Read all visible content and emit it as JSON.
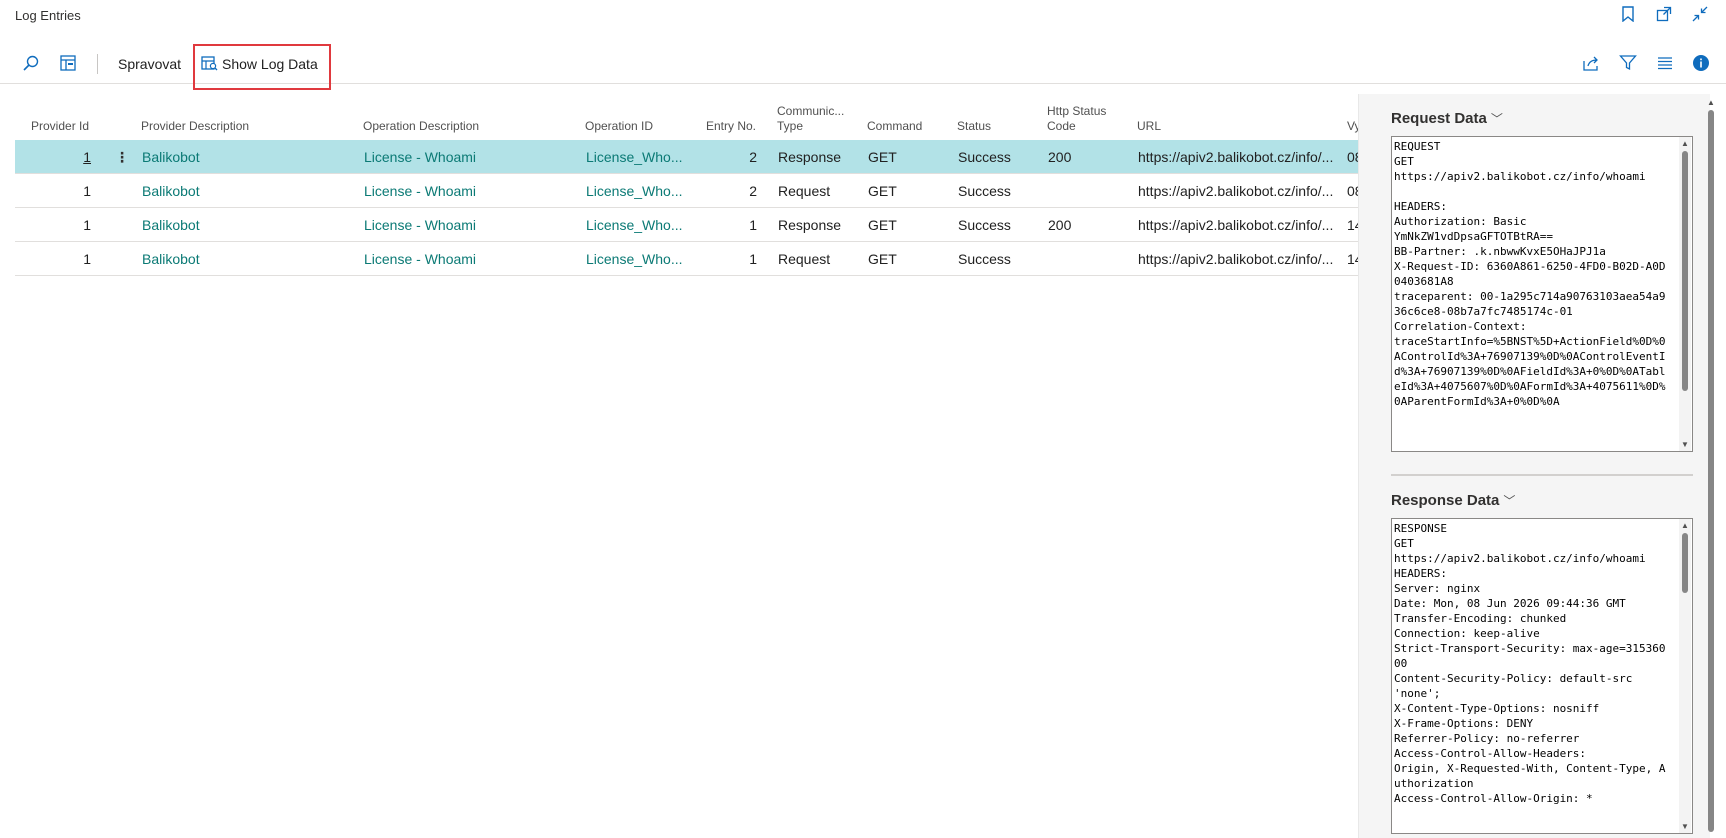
{
  "window": {
    "title": "Log Entries",
    "icons": [
      "bookmark-icon",
      "open-new-window-icon",
      "collapse-icon"
    ]
  },
  "actions": {
    "search_icon": "search-icon",
    "edit_list_icon": "edit-list-icon",
    "manage_label": "Spravovat",
    "show_log_data_label": "Show Log Data",
    "right_icons": [
      "share-icon",
      "filter-icon",
      "list-view-icon",
      "info-icon"
    ]
  },
  "grid": {
    "columns": {
      "provider_id": "Provider Id",
      "provider_description": "Provider Description",
      "operation_description": "Operation Description",
      "operation_id": "Operation ID",
      "entry_no": "Entry No.",
      "communication_type_line1": "Communic...",
      "communication_type_line2": "Type",
      "command": "Command",
      "status": "Status",
      "http_status_line1": "Http Status",
      "http_status_line2": "Code",
      "url": "URL",
      "extra": "Vy"
    },
    "rows": [
      {
        "provider_id": "1",
        "provider_description": "Balikobot",
        "operation_description": "License - Whoami",
        "operation_id": "License_Who...",
        "entry_no": "2",
        "type": "Response",
        "command": "GET",
        "status": "Success",
        "http_status": "200",
        "url": "https://apiv2.balikobot.cz/info/...",
        "extra": "08"
      },
      {
        "provider_id": "1",
        "provider_description": "Balikobot",
        "operation_description": "License - Whoami",
        "operation_id": "License_Who...",
        "entry_no": "2",
        "type": "Request",
        "command": "GET",
        "status": "Success",
        "http_status": "",
        "url": "https://apiv2.balikobot.cz/info/...",
        "extra": "08"
      },
      {
        "provider_id": "1",
        "provider_description": "Balikobot",
        "operation_description": "License - Whoami",
        "operation_id": "License_Who...",
        "entry_no": "1",
        "type": "Response",
        "command": "GET",
        "status": "Success",
        "http_status": "200",
        "url": "https://apiv2.balikobot.cz/info/...",
        "extra": "14"
      },
      {
        "provider_id": "1",
        "provider_description": "Balikobot",
        "operation_description": "License - Whoami",
        "operation_id": "License_Who...",
        "entry_no": "1",
        "type": "Request",
        "command": "GET",
        "status": "Success",
        "http_status": "",
        "url": "https://apiv2.balikobot.cz/info/...",
        "extra": "14"
      }
    ]
  },
  "request_panel": {
    "title": "Request Data",
    "content": "REQUEST\nGET\nhttps://apiv2.balikobot.cz/info/whoami\n\nHEADERS:\nAuthorization: Basic\nYmNkZW1vdDpsaGFTOTBtRA==\nBB-Partner: .k.nbwwKvxE5OHaJPJ1a\nX-Request-ID: 6360A861-6250-4FD0-B02D-A0D0403681A8\ntraceparent: 00-1a295c714a90763103aea54a936c6ce8-08b7a7fc7485174c-01\nCorrelation-Context:\ntraceStartInfo=%5BNST%5D+ActionField%0D%0AControlId%3A+76907139%0D%0AControlEventId%3A+76907139%0D%0AFieldId%3A+0%0D%0ATableId%3A+4075607%0D%0AFormId%3A+4075611%0D%0AParentFormId%3A+0%0D%0A"
  },
  "response_panel": {
    "title": "Response Data",
    "content": "RESPONSE\nGET\nhttps://apiv2.balikobot.cz/info/whoami\nHEADERS:\nServer: nginx\nDate: Mon, 08 Jun 2026 09:44:36 GMT\nTransfer-Encoding: chunked\nConnection: keep-alive\nStrict-Transport-Security: max-age=31536000\nContent-Security-Policy: default-src\n'none';\nX-Content-Type-Options: nosniff\nX-Frame-Options: DENY\nReferrer-Policy: no-referrer\nAccess-Control-Allow-Headers:\nOrigin, X-Requested-With, Content-Type, Authorization\nAccess-Control-Allow-Origin: *"
  },
  "colors": {
    "accent": "#0f6cbd",
    "link_teal": "#0b7a75",
    "selected_row": "#b2e2e7",
    "highlight_border": "#e0393e"
  }
}
